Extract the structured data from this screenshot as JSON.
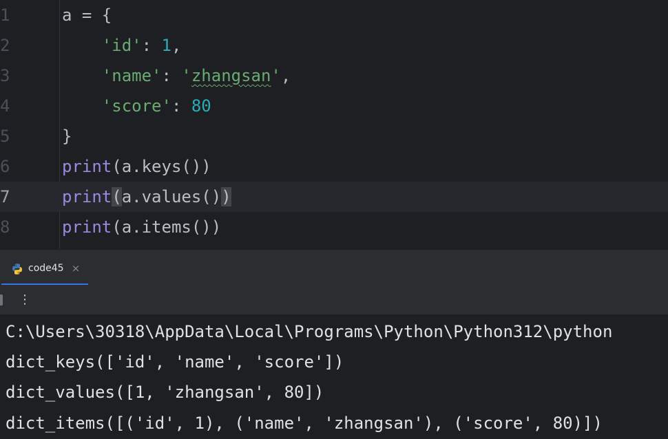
{
  "editor": {
    "lines": [
      {
        "number": "1"
      },
      {
        "number": "2"
      },
      {
        "number": "3"
      },
      {
        "number": "4"
      },
      {
        "number": "5"
      },
      {
        "number": "6"
      },
      {
        "number": "7"
      },
      {
        "number": "8"
      }
    ],
    "tokens": {
      "l1": "a = {",
      "l2_key": "'id'",
      "l2_colon": ": ",
      "l2_val": "1",
      "l2_comma": ",",
      "l3_key": "'name'",
      "l3_colon": ": ",
      "l3_q1": "'",
      "l3_val": "zhangsan",
      "l3_q2": "'",
      "l3_comma": ",",
      "l4_key": "'score'",
      "l4_colon": ": ",
      "l4_val": "80",
      "l5": "}",
      "l6_fn": "print",
      "l6_rest": "(a.keys())",
      "l7_fn": "print",
      "l7_open": "(",
      "l7_mid": "a.values()",
      "l7_close": ")",
      "l8_fn": "print",
      "l8_rest": "(a.items())"
    },
    "current_line": "7"
  },
  "run_panel": {
    "tab_label": "code45",
    "tab_icon": "python-icon",
    "close_glyph": "×",
    "more_glyph": "⋮",
    "accent_color": "#3574f0"
  },
  "console": {
    "lines": [
      "C:\\Users\\30318\\AppData\\Local\\Programs\\Python\\Python312\\python",
      "dict_keys(['id', 'name', 'score'])",
      "dict_values([1, 'zhangsan', 80])",
      "dict_items([('id', 1), ('name', 'zhangsan'), ('score', 80)])"
    ]
  }
}
